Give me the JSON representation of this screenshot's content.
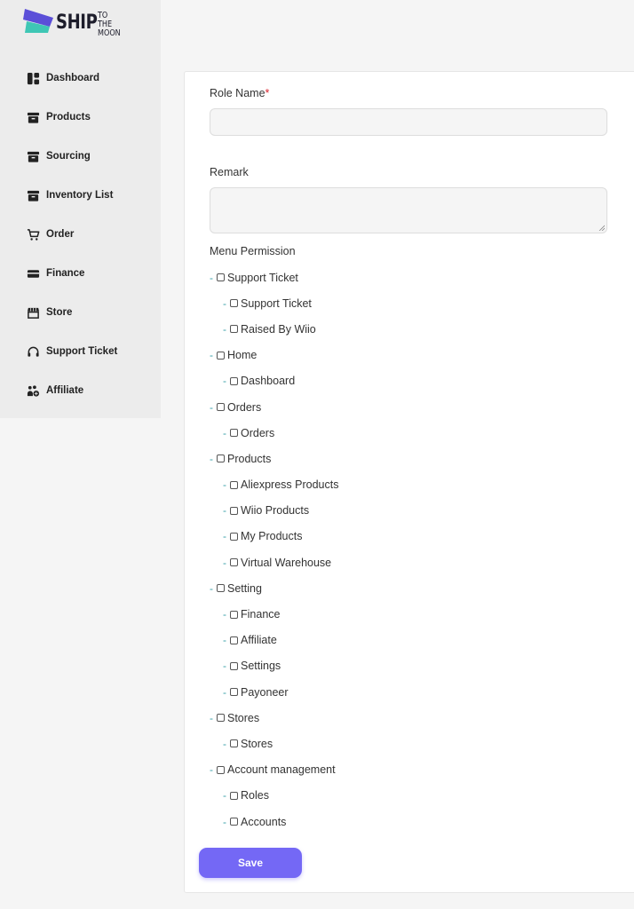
{
  "logo": {
    "main": "SHIP",
    "small_line1": "TO THE",
    "small_line2": "MOON"
  },
  "sidebar": {
    "items": [
      {
        "label": "Dashboard",
        "icon": "dashboard-icon"
      },
      {
        "label": "Products",
        "icon": "archive-box-icon"
      },
      {
        "label": "Sourcing",
        "icon": "archive-box-icon"
      },
      {
        "label": "Inventory List",
        "icon": "archive-box-icon"
      },
      {
        "label": "Order",
        "icon": "cart-icon"
      },
      {
        "label": "Finance",
        "icon": "wallet-icon"
      },
      {
        "label": "Store",
        "icon": "store-icon"
      },
      {
        "label": "Support Ticket",
        "icon": "headset-icon"
      },
      {
        "label": "Affiliate",
        "icon": "affiliate-icon"
      }
    ]
  },
  "form": {
    "role_name_label": "Role Name",
    "required_mark": "*",
    "role_name_value": "",
    "remark_label": "Remark",
    "remark_value": "",
    "menu_permission_label": "Menu Permission",
    "dash": "-",
    "permissions": [
      {
        "label": "Support Ticket",
        "children": [
          "Support Ticket",
          "Raised By Wiio"
        ]
      },
      {
        "label": "Home",
        "children": [
          "Dashboard"
        ]
      },
      {
        "label": "Orders",
        "children": [
          "Orders"
        ]
      },
      {
        "label": "Products",
        "children": [
          "Aliexpress Products",
          "Wiio Products",
          "My Products",
          "Virtual Warehouse"
        ]
      },
      {
        "label": "Setting",
        "children": [
          "Finance",
          "Affiliate",
          "Settings",
          "Payoneer"
        ]
      },
      {
        "label": "Stores",
        "children": [
          "Stores"
        ]
      },
      {
        "label": "Account management",
        "children": [
          "Roles",
          "Accounts"
        ]
      }
    ],
    "save_label": "Save"
  },
  "colors": {
    "accent": "#7468f5",
    "sidebar_bg": "#ececec",
    "dash": "#3aa0a8",
    "required": "#d9232e"
  }
}
